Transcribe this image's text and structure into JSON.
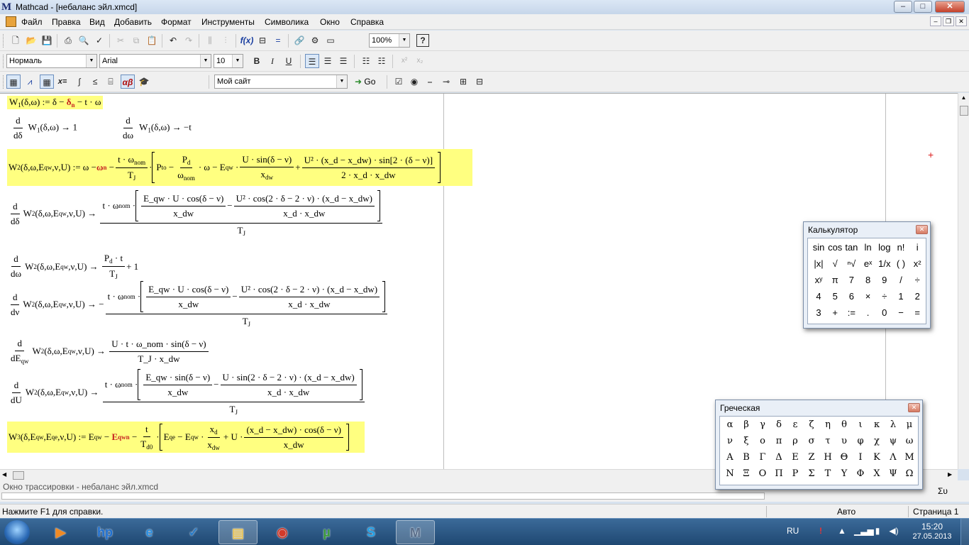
{
  "window": {
    "logo": "M",
    "title": "Mathcad - [небаланс эйл.xmcd]",
    "minimize": "–",
    "maximize": "□",
    "close": "✕"
  },
  "menu": [
    "Файл",
    "Правка",
    "Вид",
    "Добавить",
    "Формат",
    "Инструменты",
    "Символика",
    "Окно",
    "Справка"
  ],
  "mdi_controls": {
    "minimize": "–",
    "restore": "❐",
    "close": "✕"
  },
  "standard_toolbar": {
    "zoom": "100%",
    "help": "?"
  },
  "format_toolbar": {
    "style": "Нормаль",
    "font": "Arial",
    "size": "10",
    "bold": "B",
    "italic": "I",
    "underline": "U",
    "superscript": "x²",
    "subscript": "x₂"
  },
  "math_toolbar": {
    "site_combo": "Мой сайт",
    "go": "Go",
    "buttons": [
      "calculator",
      "graph",
      "matrix",
      "evaluation",
      "calculus",
      "boolean",
      "programming",
      "greek",
      "symbolic"
    ],
    "eval_label": "x=",
    "greek_label": "αβ"
  },
  "worksheet": {
    "eq1": {
      "lhs": "W",
      "lhs_sub": "1",
      "args": "(δ,ω)",
      "assign": ":=",
      "rhs_a": "δ − ",
      "rhs_red": "δ",
      "rhs_red_sub": "n",
      "rhs_b": "− t · ω"
    },
    "eq1_d1": {
      "d": "d",
      "dvar": "dδ",
      "f": "W",
      "f_sub": "1",
      "args": "(δ,ω)",
      "arrow": "→",
      "result": "1"
    },
    "eq1_d2": {
      "d": "d",
      "dvar": "dω",
      "f": "W",
      "f_sub": "1",
      "args": "(δ,ω)",
      "arrow": "→",
      "result": "−t"
    },
    "eq2": {
      "lhs": "W",
      "lhs_sub": "2",
      "args": "(δ,ω,E",
      "args_sub": "qw",
      "args_end": ",ν,U)",
      "assign": ":=",
      "a": "ω − ",
      "red": "ω",
      "red_sub": "n",
      "minus": "−",
      "f1_num": "t · ω",
      "f1_num_sub": "nom",
      "f1_den": "T",
      "f1_den_sub": "J",
      "dot": "·",
      "p_to": "P",
      "p_to_sub": "to",
      "minus2": "−",
      "f2_num": "P",
      "f2_num_sub": "d",
      "f2_den": "ω",
      "f2_den_sub": "nom",
      "b": "· ω − E",
      "b_sub": "qw",
      "dot2": "·",
      "f3_num": "U · sin(δ − ν)",
      "f3_den": "x",
      "f3_den_sub": "dw",
      "plus": "+",
      "f4_num": "U² · (x_d − x_dw) · sin[2 · (δ − ν)]",
      "f4_den": "2 · x_d · x_dw"
    },
    "eq2_dd": {
      "d": "d",
      "dvar": "dδ",
      "f": "W",
      "f_sub": "2",
      "args": "(δ,ω,E",
      "args_sub": "qw",
      "args_end": ",ν,U)",
      "arrow": "→",
      "pre": "t · ω",
      "pre_sub": "nom",
      "dot": "·",
      "n1": "E_qw · U · cos(δ − ν)",
      "d1": "x_dw",
      "minus": "−",
      "n2": "U² · cos(2 · δ − 2 · ν) · (x_d − x_dw)",
      "d2": "x_d · x_dw",
      "den": "T",
      "den_sub": "J"
    },
    "eq2_dw": {
      "d": "d",
      "dvar": "dω",
      "f": "W",
      "f_sub": "2",
      "args": "(δ,ω,E",
      "args_sub": "qw",
      "args_end": ",ν,U)",
      "arrow": "→",
      "num": "P",
      "num_sub": "d",
      "num_rest": " · t",
      "den": "T",
      "den_sub": "J",
      "plus": "+ 1"
    },
    "eq2_dnu": {
      "d": "d",
      "dvar": "dν",
      "f": "W",
      "f_sub": "2",
      "args": "(δ,ω,E",
      "args_sub": "qw",
      "args_end": ",ν,U)",
      "arrow": "→",
      "neg": "−",
      "pre": "t · ω",
      "pre_sub": "nom",
      "dot": "·",
      "n1": "E_qw · U · cos(δ − ν)",
      "d1": "x_dw",
      "minus": "−",
      "n2": "U² · cos(2 · δ − 2 · ν) · (x_d − x_dw)",
      "d2": "x_d · x_dw",
      "den": "T",
      "den_sub": "J"
    },
    "eq2_de": {
      "d": "d",
      "dvar": "dE",
      "dvar_sub": "qw",
      "f": "W",
      "f_sub": "2",
      "args": "(δ,ω,E",
      "args_sub": "qw",
      "args_end": ",ν,U)",
      "arrow": "→",
      "num": "U · t · ω_nom · sin(δ − ν)",
      "den": "T_J · x_dw"
    },
    "eq2_du": {
      "d": "d",
      "dvar": "dU",
      "f": "W",
      "f_sub": "2",
      "args": "(δ,ω,E",
      "args_sub": "qw",
      "args_end": ",ν,U)",
      "arrow": "→",
      "pre": "t · ω",
      "pre_sub": "nom",
      "dot": "·",
      "n1": "E_qw · sin(δ − ν)",
      "d1": "x_dw",
      "minus": "−",
      "n2": "U · sin(2 · δ − 2 · ν) · (x_d − x_dw)",
      "d2": "x_d · x_dw",
      "den": "T",
      "den_sub": "J"
    },
    "eq3": {
      "lhs": "W",
      "lhs_sub": "3",
      "args": "(δ,E",
      "args_sub": "qw",
      "args_mid": ",E",
      "args_sub2": "qe",
      "args_end": ",ν,U)",
      "assign": ":=",
      "a": "E",
      "a_sub": "qw",
      "minus": "−",
      "red": "E",
      "red_sub": "qwn",
      "minus2": "−",
      "f1_num": "t",
      "f1_den": "T",
      "f1_den_sub": "d0",
      "dot": "·",
      "b": "E",
      "b_sub": "qe",
      "c": "− E",
      "c_sub": "qw",
      "dot2": "·",
      "f2_num": "x",
      "f2_num_sub": "d",
      "f2_den": "x",
      "f2_den_sub": "dw",
      "plus": "+ U ·",
      "f3_num": "(x_d − x_dw) · cos(δ − ν)",
      "f3_den": "x_dw"
    },
    "cursor": "+"
  },
  "calculator": {
    "title": "Калькулятор",
    "close": "✕",
    "rows": [
      [
        "sin",
        "cos",
        "tan",
        "ln",
        "log",
        "n!",
        "i"
      ],
      [
        "|x|",
        "√",
        "ⁿ√",
        "eˣ",
        "1/x",
        "( )",
        "x²"
      ],
      [
        "xʸ",
        "π",
        "7",
        "8",
        "9",
        "/",
        "÷"
      ],
      [
        "4",
        "5",
        "6",
        "×",
        "÷",
        "1",
        "2"
      ],
      [
        "3",
        "+",
        ":=",
        ".",
        "0",
        "−",
        "="
      ]
    ]
  },
  "greek": {
    "title": "Греческая",
    "close": "✕",
    "rows": [
      [
        "α",
        "β",
        "γ",
        "δ",
        "ε",
        "ζ",
        "η",
        "θ",
        "ι",
        "κ",
        "λ",
        "μ"
      ],
      [
        "ν",
        "ξ",
        "ο",
        "π",
        "ρ",
        "σ",
        "τ",
        "υ",
        "φ",
        "χ",
        "ψ",
        "ω"
      ],
      [
        "Α",
        "Β",
        "Γ",
        "Δ",
        "Ε",
        "Ζ",
        "Η",
        "Θ",
        "Ι",
        "Κ",
        "Λ",
        "Μ"
      ],
      [
        "Ν",
        "Ξ",
        "Ο",
        "Π",
        "Ρ",
        "Σ",
        "Τ",
        "Υ",
        "Φ",
        "Χ",
        "Ψ",
        "Ω"
      ]
    ]
  },
  "trace": {
    "label": "Окно трассировки - небаланс эйл.xmcd",
    "sigma": "Συ"
  },
  "status": {
    "help": "Нажмите F1 для справки.",
    "mode": "Авто",
    "page": "Страница 1"
  },
  "taskbar": {
    "apps": [
      "media-player",
      "hp",
      "internet-explorer",
      "task-manager",
      "file-explorer",
      "chrome",
      "utorrent",
      "skype",
      "mathcad"
    ],
    "app_glyphs": [
      "▶",
      "hp",
      "e",
      "✓",
      "▤",
      "◉",
      "µ",
      "S",
      "M"
    ],
    "lang": "RU",
    "time": "15:20",
    "date": "27.05.2013"
  }
}
